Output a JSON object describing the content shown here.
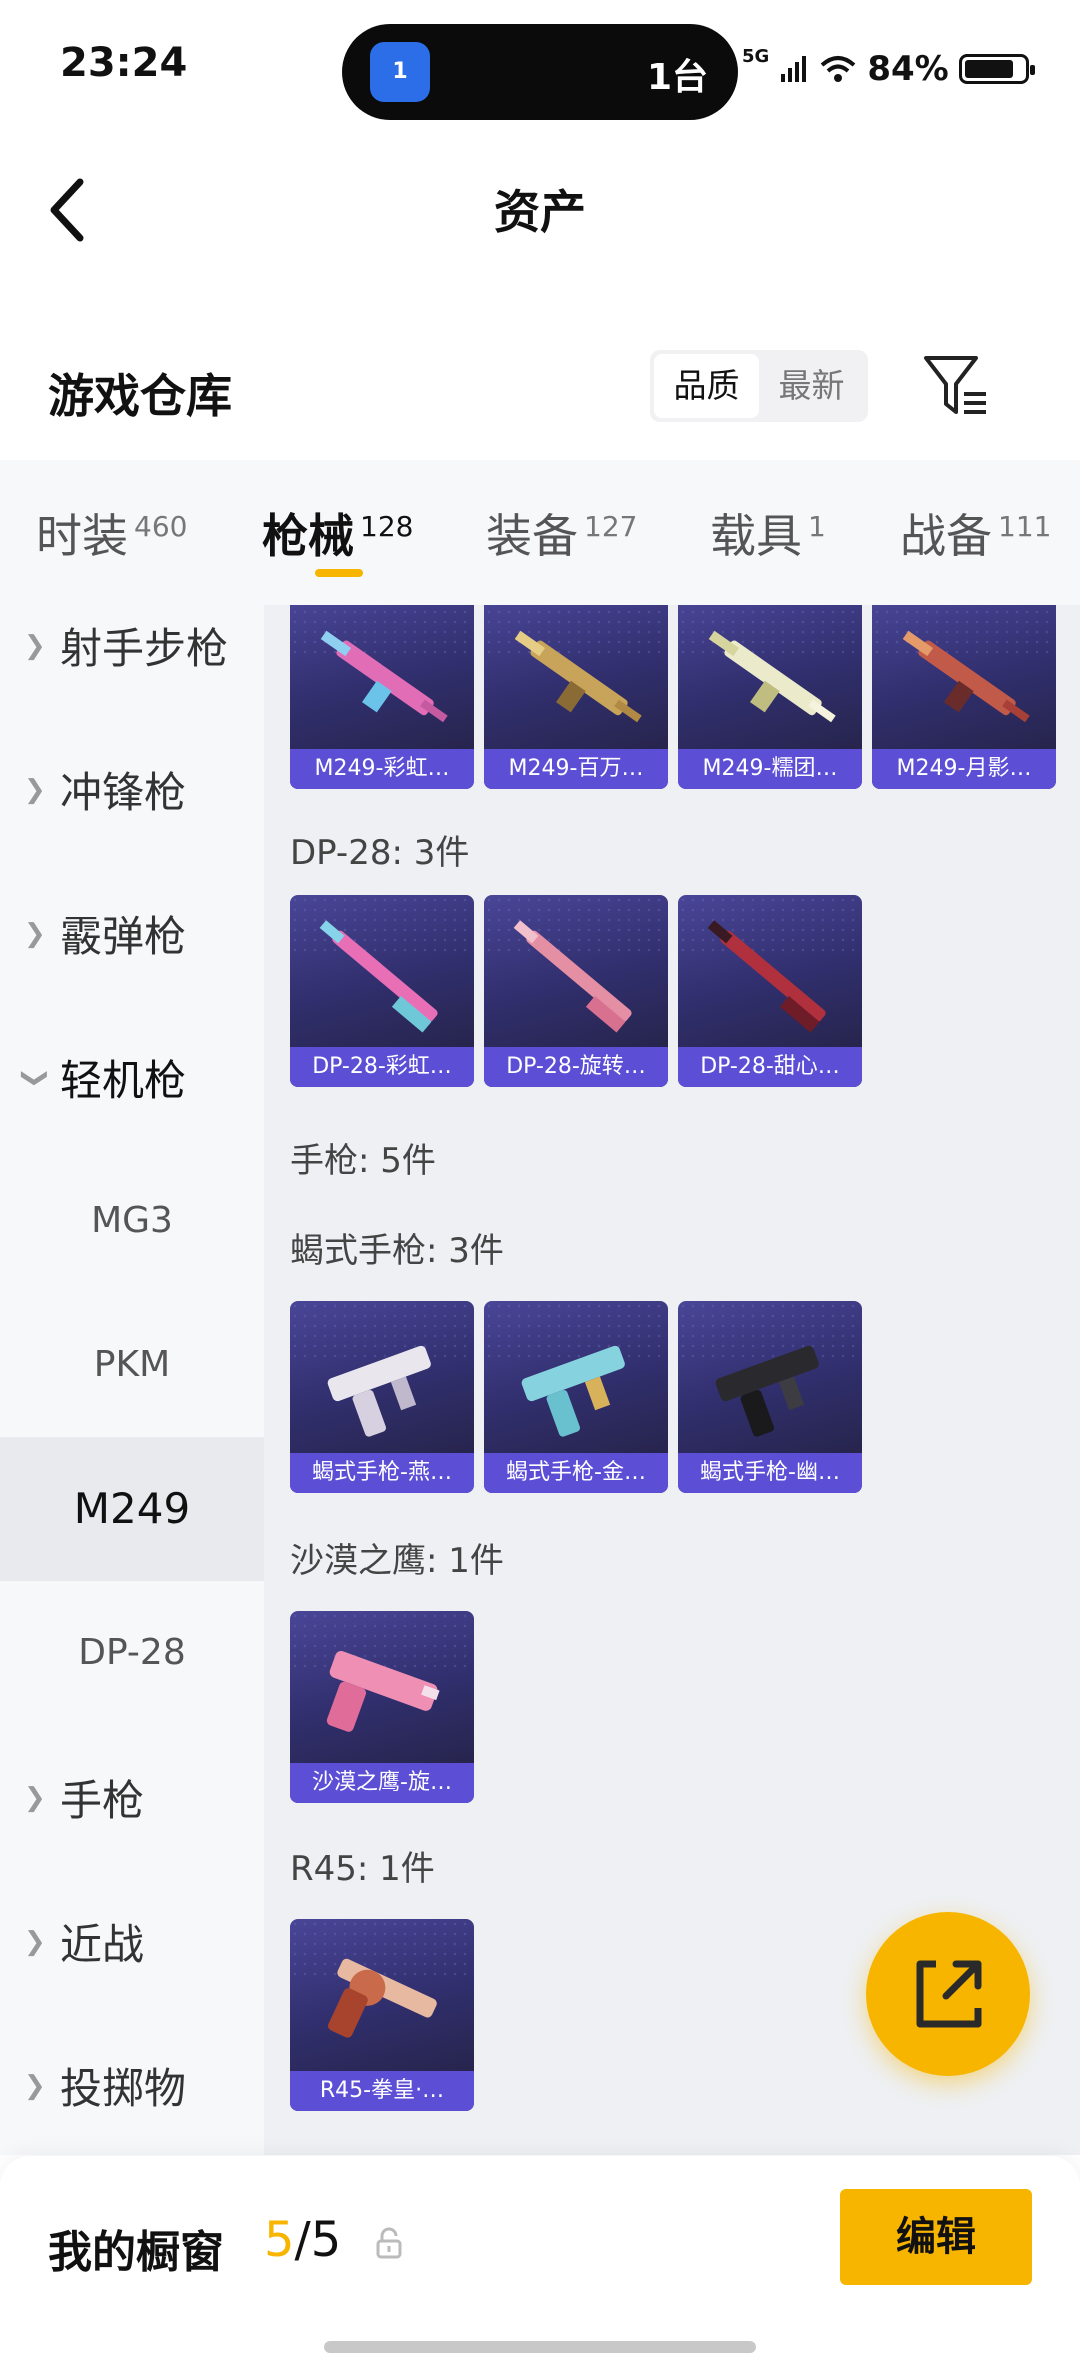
{
  "status": {
    "time": "23:24",
    "island_app": "1",
    "island_text": "1台",
    "network": "5G",
    "battery": "84%",
    "battery_level": 0.84
  },
  "header": {
    "title": "资产"
  },
  "warehouse": {
    "title": "游戏仓库",
    "sort_options": [
      "品质",
      "最新"
    ],
    "active_sort": "品质"
  },
  "tabs": [
    {
      "label": "时装",
      "count": "460"
    },
    {
      "label": "枪械",
      "count": "128"
    },
    {
      "label": "装备",
      "count": "127"
    },
    {
      "label": "载具",
      "count": "1"
    },
    {
      "label": "战备",
      "count": "111"
    }
  ],
  "sidebar": {
    "categories": [
      "射手步枪",
      "冲锋枪",
      "霰弹枪",
      "轻机枪",
      "手枪",
      "近战",
      "投掷物"
    ],
    "sub_items": [
      "MG3",
      "PKM",
      "M249",
      "DP-28"
    ],
    "selected": "M249"
  },
  "content": {
    "m249_cards": [
      "M249-彩虹…",
      "M249-百万…",
      "M249-糯团…",
      "M249-月影…"
    ],
    "dp28_header": "DP-28: 3件",
    "dp28_cards": [
      "DP-28-彩虹…",
      "DP-28-旋转…",
      "DP-28-甜心…"
    ],
    "pistol_header": "手枪: 5件",
    "scorpion_header": "蝎式手枪: 3件",
    "scorpion_cards": [
      "蝎式手枪-燕…",
      "蝎式手枪-金…",
      "蝎式手枪-幽…"
    ],
    "deagle_header": "沙漠之鹰: 1件",
    "deagle_cards": [
      "沙漠之鹰-旋…"
    ],
    "r45_header": "R45: 1件",
    "r45_cards": [
      "R45-拳皇·…"
    ]
  },
  "bottom": {
    "showcase_label": "我的橱窗",
    "showcase_used": "5",
    "showcase_total": "/5",
    "edit_label": "编辑"
  },
  "colors": {
    "accent": "#f7b500",
    "card_label": "#5c4fd6",
    "card_bg": "#312f6e"
  },
  "icons": {
    "back": "chevron-left-icon",
    "filter": "filter-icon",
    "fab": "share-export-icon",
    "lock": "lock-icon"
  }
}
